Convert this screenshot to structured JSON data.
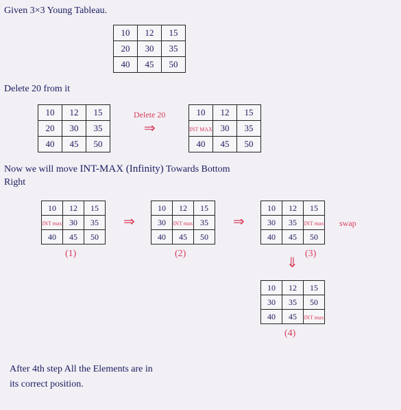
{
  "heading1": "Given  3×3  Young  Tableau.",
  "t0": {
    "r0": [
      "10",
      "12",
      "15"
    ],
    "r1": [
      "20",
      "30",
      "35"
    ],
    "r2": [
      "40",
      "45",
      "50"
    ]
  },
  "heading2": "Delete  20  from  it",
  "t1": {
    "r0": [
      "10",
      "12",
      "15"
    ],
    "r1": [
      "20",
      "30",
      "35"
    ],
    "r2": [
      "40",
      "45",
      "50"
    ]
  },
  "del_label": "Delete 20",
  "arrow1": "⇒",
  "t2": {
    "r0": [
      "10",
      "12",
      "15"
    ],
    "r1": [
      "INT MAX",
      "30",
      "35"
    ],
    "r2": [
      "40",
      "45",
      "50"
    ]
  },
  "line3a": "Now  we  will  move  ",
  "line3b": "INT-MAX (Infinity)",
  "line3c": "  Towards  Bottom",
  "line3d": "Right",
  "s1": {
    "r0": [
      "10",
      "12",
      "15"
    ],
    "r1": [
      "INT max",
      "30",
      "35"
    ],
    "r2": [
      "40",
      "45",
      "50"
    ]
  },
  "s2": {
    "r0": [
      "10",
      "12",
      "15"
    ],
    "r1": [
      "30",
      "INT max",
      "35"
    ],
    "r2": [
      "40",
      "45",
      "50"
    ]
  },
  "s3": {
    "r0": [
      "10",
      "12",
      "15"
    ],
    "r1": [
      "30",
      "35",
      "INT max"
    ],
    "r2": [
      "40",
      "45",
      "50"
    ]
  },
  "s4": {
    "r0": [
      "10",
      "12",
      "15"
    ],
    "r1": [
      "30",
      "35",
      "50"
    ],
    "r2": [
      "40",
      "45",
      "INT max"
    ]
  },
  "step_arrow": "⇒",
  "step_arrow_down": "⇓",
  "caption1": "(1)",
  "caption2": "(2)",
  "caption3": "(3)",
  "caption4": "(4)",
  "swap": "swap",
  "footer1": "After  4th  step  All  the  Elements  are  in",
  "footer2": "its  correct  position."
}
